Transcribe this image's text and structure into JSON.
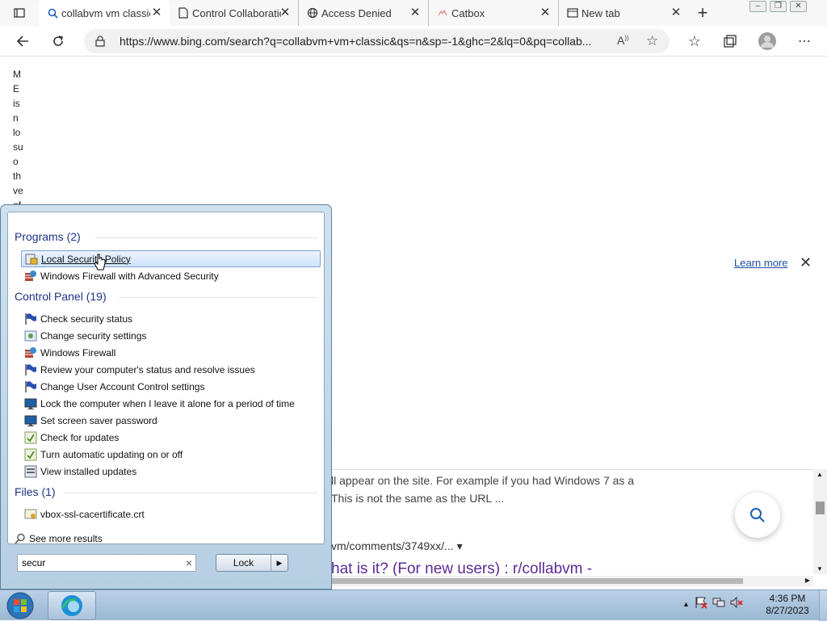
{
  "browser": {
    "tabs": [
      {
        "title": "collabvm vm classic"
      },
      {
        "title": "Control Collaboration"
      },
      {
        "title": "Access Denied"
      },
      {
        "title": "Catbox"
      },
      {
        "title": "New tab"
      }
    ],
    "new_tab": "+",
    "close_glyph": "✕",
    "address": "https://www.bing.com/search?q=collabvm+vm+classic&qs=n&sp=-1&ghc=2&lq=0&pq=collab..."
  },
  "page": {
    "vertical_text": [
      "M",
      "E",
      "is",
      "n",
      "lo",
      "su",
      "o",
      "th",
      "ve",
      "of"
    ],
    "learn_more": "Learn more",
    "snippet_line1": "ll appear on the site. For example if you had Windows 7 as a",
    "snippet_line2": "This is not the same as the URL ...",
    "cite": "vm/comments/3749xx/... ▾",
    "result_title": "hat is it? (For new users) : r/collabvm -"
  },
  "start_menu": {
    "programs_header": "Programs (2)",
    "programs": [
      {
        "label": "Local Security Policy",
        "icon": "security-policy-icon"
      },
      {
        "label": "Windows Firewall with Advanced Security",
        "icon": "firewall-icon"
      }
    ],
    "control_panel_header": "Control Panel (19)",
    "control_panel": [
      {
        "label": "Check security status",
        "icon": "flag-icon"
      },
      {
        "label": "Change security settings",
        "icon": "security-settings-icon"
      },
      {
        "label": "Windows Firewall",
        "icon": "firewall-icon"
      },
      {
        "label": "Review your computer's status and resolve issues",
        "icon": "flag-icon"
      },
      {
        "label": "Change User Account Control settings",
        "icon": "flag-icon"
      },
      {
        "label": "Lock the computer when I leave it alone for a period of time",
        "icon": "monitor-icon"
      },
      {
        "label": "Set screen saver password",
        "icon": "monitor-icon"
      },
      {
        "label": "Check for updates",
        "icon": "update-icon"
      },
      {
        "label": "Turn automatic updating on or off",
        "icon": "update-icon"
      },
      {
        "label": "View installed updates",
        "icon": "installed-updates-icon"
      }
    ],
    "files_header": "Files (1)",
    "files": [
      {
        "label": "vbox-ssl-cacertificate.crt",
        "icon": "certificate-icon"
      }
    ],
    "see_more": "See more results",
    "search_value": "secur",
    "clear_glyph": "×",
    "lock_label": "Lock",
    "lock_arrow": "▶"
  },
  "taskbar": {
    "time": "4:36 PM",
    "date": "8/27/2023"
  },
  "colors": {
    "accent": "#1e3287",
    "link": "#1a4fa3",
    "visited": "#5e2a95"
  }
}
